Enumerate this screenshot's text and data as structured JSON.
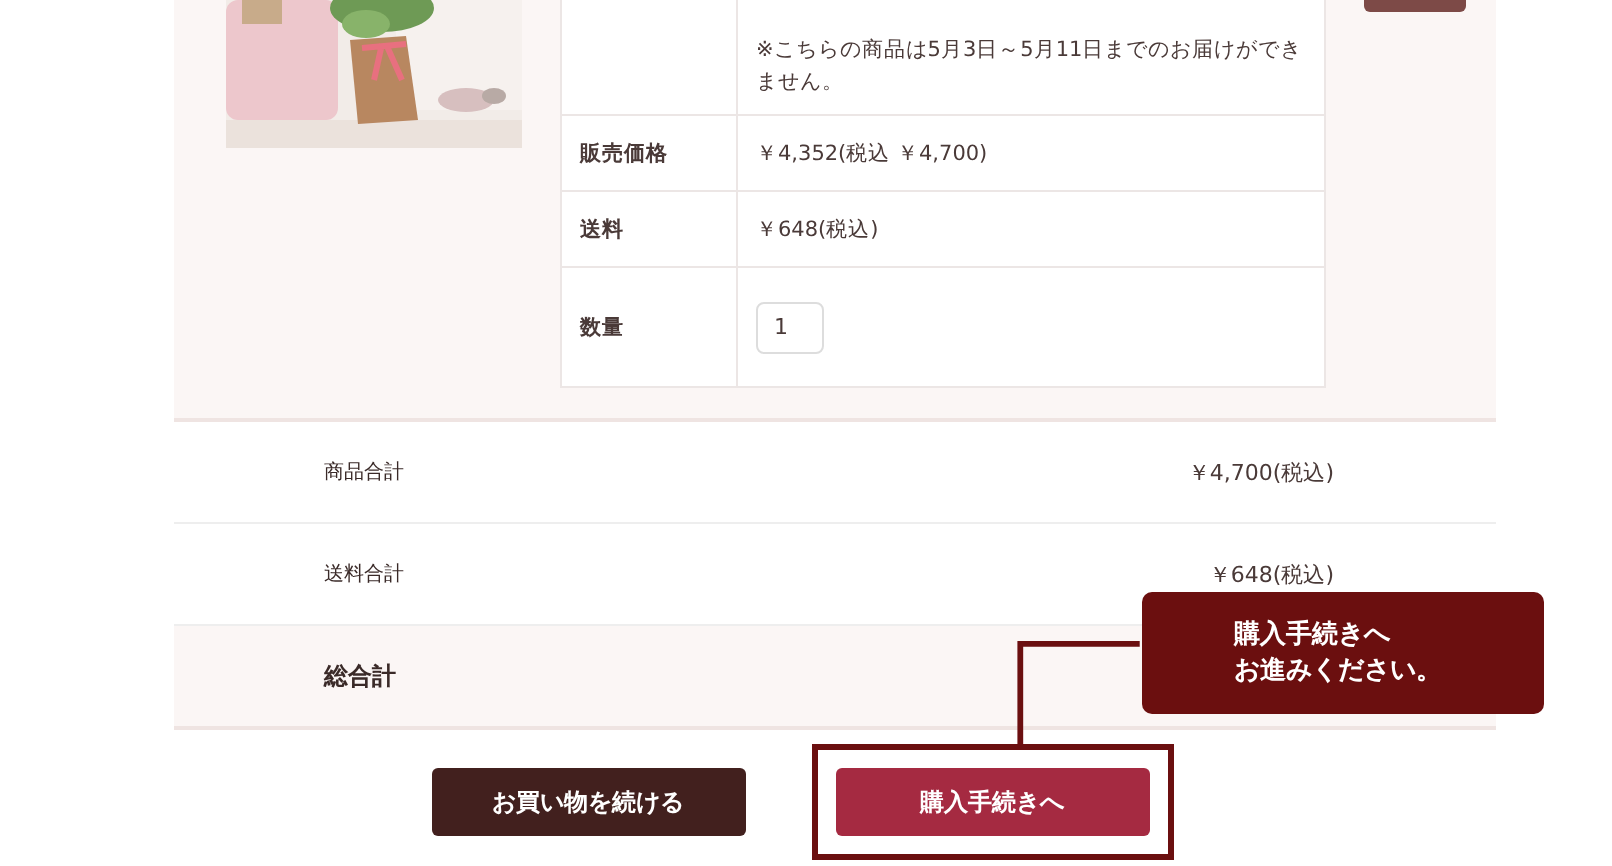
{
  "product": {
    "details": [
      {
        "value": "※こちらの商品は5月3日～5月11日までのお届けができません。",
        "kind": "text"
      },
      {
        "label": "販売価格",
        "value": "￥4,352(税込 ￥4,700)",
        "kind": "text"
      },
      {
        "label": "送料",
        "value": "￥648(税込)",
        "kind": "text"
      },
      {
        "label": "数量",
        "value": "1",
        "kind": "quantity"
      }
    ]
  },
  "summary": [
    {
      "label": "商品合計",
      "value": "￥4,700(税込)",
      "kind": "row"
    },
    {
      "label": "送料合計",
      "value": "￥648(税込)",
      "kind": "row"
    },
    {
      "label": "総合計",
      "kind": "total"
    }
  ],
  "buttons": [
    {
      "label": "お買い物を続ける",
      "kind": "secondary",
      "highlighted": false
    },
    {
      "label": "購入手続きへ",
      "kind": "primary",
      "highlighted": true
    }
  ],
  "callout": {
    "lines": [
      "購入手続きへ",
      "お進みください。"
    ]
  }
}
